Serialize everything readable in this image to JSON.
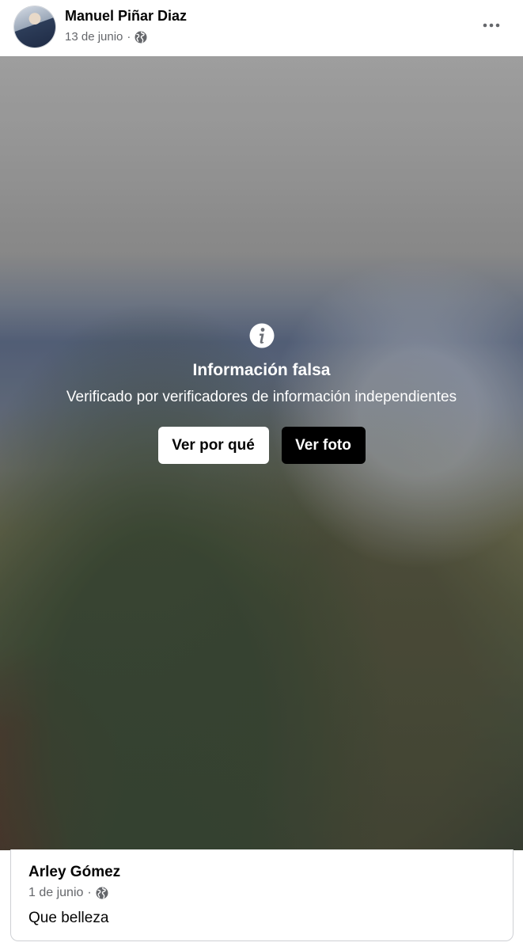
{
  "post": {
    "author": "Manuel Piñar Diaz",
    "date": "13 de junio",
    "separator": "·",
    "audience_icon": "globe-icon",
    "menu_icon": "more-options-icon"
  },
  "warning": {
    "icon": "info-icon",
    "title": "Información falsa",
    "subtitle": "Verificado por verificadores de información independientes",
    "why_button": "Ver por qué",
    "photo_button": "Ver foto"
  },
  "comment": {
    "author": "Arley Gómez",
    "date": "1 de junio",
    "separator": "·",
    "audience_icon": "globe-icon",
    "text": "Que belleza"
  },
  "colors": {
    "text_primary": "#050505",
    "text_secondary": "#65676b",
    "button_dark": "#000000",
    "button_light": "#ffffff"
  }
}
